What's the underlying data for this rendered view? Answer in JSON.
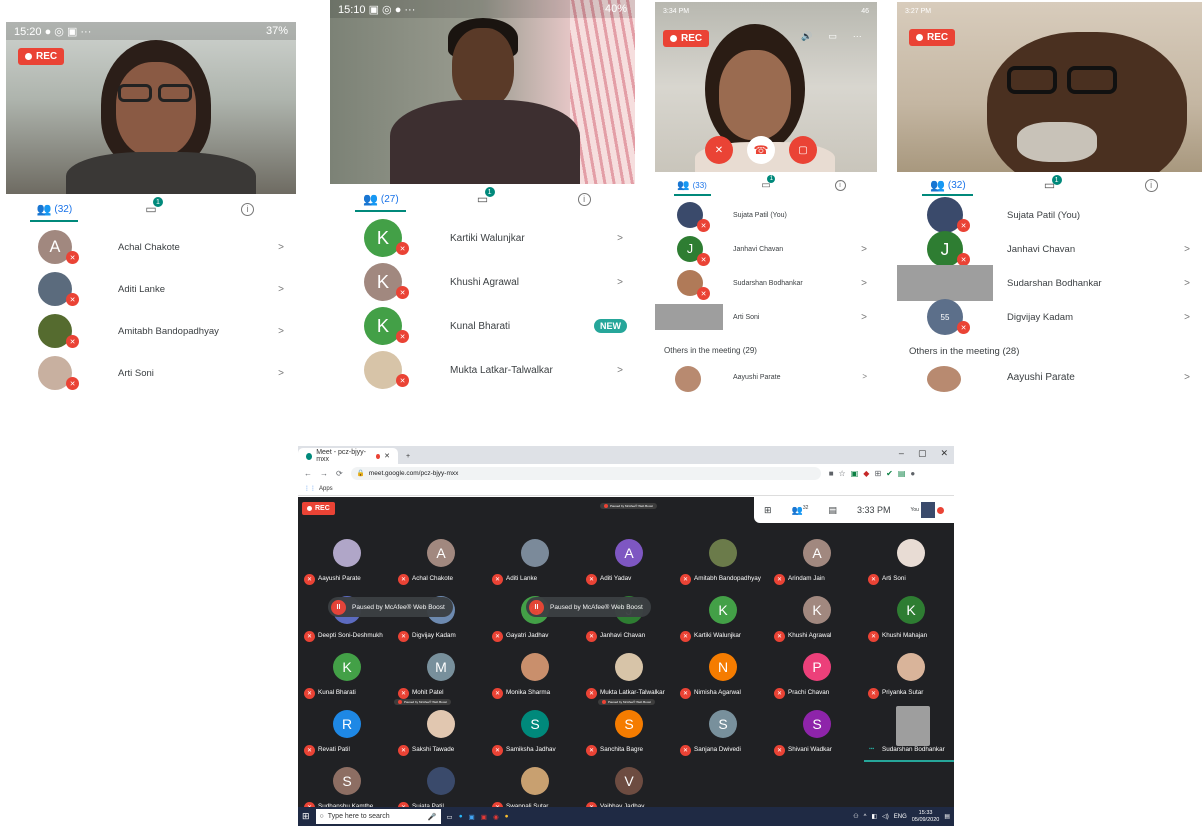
{
  "phone1": {
    "status_time": "15:20",
    "status_icons": "● ◎ ▣ ···",
    "battery": "37%",
    "rec": "REC",
    "participants_count": "(32)",
    "chat_badge": "1",
    "participants": [
      {
        "name": "Achal Chakote",
        "initial": "A",
        "color": "#a1887f"
      },
      {
        "name": "Aditi Lanke",
        "initial": "",
        "color": "#5b6b7d"
      },
      {
        "name": "Amitabh Bandopadhyay",
        "initial": "",
        "color": "#556b2f"
      },
      {
        "name": "Arti Soni",
        "initial": "",
        "color": "#c8b0a0"
      }
    ]
  },
  "phone2": {
    "status_time": "15:10",
    "status_icons": "▣ ◎ ● ···",
    "battery": "40%",
    "participants_count": "(27)",
    "chat_badge": "1",
    "participants": [
      {
        "name": "Kartiki Walunjkar",
        "initial": "K",
        "color": "#43a047",
        "new": ""
      },
      {
        "name": "Khushi Agrawal",
        "initial": "K",
        "color": "#a1887f",
        "new": ""
      },
      {
        "name": "Kunal Bharati",
        "initial": "K",
        "color": "#43a047",
        "new": "NEW"
      },
      {
        "name": "Mukta Latkar-Talwalkar",
        "initial": "",
        "color": "#d7c4a8",
        "new": ""
      }
    ]
  },
  "phone3": {
    "status_time": "3:34 PM",
    "signal": "46",
    "rec": "REC",
    "participants_count": "(33)",
    "chat_badge": "1",
    "participants": [
      {
        "name": "Sujata Patil (You)",
        "initial": "",
        "color": "#3a4a6b"
      },
      {
        "name": "Janhavi Chavan",
        "initial": "J",
        "color": "#2e7d32"
      },
      {
        "name": "Sudarshan Bodhankar",
        "initial": "",
        "color": "#b07a58"
      },
      {
        "name": "Arti Soni",
        "initial": "",
        "color": "#9e9e9e"
      }
    ],
    "others": "Others in the meeting (29)",
    "others_first": "Aayushi Parate"
  },
  "phone4": {
    "status_time": "3:27 PM",
    "rec": "REC",
    "participants_count": "(32)",
    "chat_badge": "1",
    "participants": [
      {
        "name": "Sujata Patil (You)",
        "initial": "",
        "color": "#3a4a6b"
      },
      {
        "name": "Janhavi Chavan",
        "initial": "J",
        "color": "#2e7d32"
      },
      {
        "name": "Sudarshan Bodhankar",
        "initial": "",
        "color": "#9e9e9e"
      },
      {
        "name": "Digvijay Kadam",
        "initial": "",
        "color": "#5c6f8a"
      }
    ],
    "digvijay_label": "55",
    "others": "Others in the meeting (28)",
    "others_first": "Aayushi Parate"
  },
  "desktop": {
    "tab_title": "Meet - pcz-bjyy-mxx",
    "new_tab": "+",
    "url": "meet.google.com/pcz-bjyy-mxx",
    "bookmarks_label": "Apps",
    "rec": "REC",
    "time": "3:33 PM",
    "participants_badge": "32",
    "you_label": "You",
    "paused_text": "Paused by McAfee® Web Boost",
    "tiny_paused_text": "Paused by McAfee® Web Boost",
    "pause_glyph": "II",
    "tiles": [
      {
        "name": "Aayushi Parate",
        "initial": "",
        "color": "#b0a6c8"
      },
      {
        "name": "Achal Chakote",
        "initial": "A",
        "color": "#a1887f"
      },
      {
        "name": "Aditi Lanke",
        "initial": "",
        "color": "#7b8a9a"
      },
      {
        "name": "Aditi Yadav",
        "initial": "A",
        "color": "#7e57c2"
      },
      {
        "name": "Amitabh Bandopadhyay",
        "initial": "",
        "color": "#6b7b4a"
      },
      {
        "name": "Arindam Jain",
        "initial": "A",
        "color": "#a1887f"
      },
      {
        "name": "Arti Soni",
        "initial": "",
        "color": "#e8dcd4"
      },
      {
        "name": "Deepti Soni-Deshmukh",
        "initial": "",
        "color": "#5c6bc0"
      },
      {
        "name": "Digvijay Kadam",
        "initial": "",
        "color": "#6d8ab0"
      },
      {
        "name": "Gayatri Jadhav",
        "initial": "G",
        "color": "#43a047"
      },
      {
        "name": "Janhavi Chavan",
        "initial": "J",
        "color": "#2e7d32"
      },
      {
        "name": "Kartiki Walunjkar",
        "initial": "K",
        "color": "#43a047"
      },
      {
        "name": "Khushi Agrawal",
        "initial": "K",
        "color": "#a1887f"
      },
      {
        "name": "Khushi Mahajan",
        "initial": "K",
        "color": "#2e7d32"
      },
      {
        "name": "Kunal Bharati",
        "initial": "K",
        "color": "#43a047"
      },
      {
        "name": "Mohit Patel",
        "initial": "M",
        "color": "#78909c"
      },
      {
        "name": "Monika Sharma",
        "initial": "",
        "color": "#c98f6c"
      },
      {
        "name": "Mukta Latkar-Talwalkar",
        "initial": "",
        "color": "#d7c4a8"
      },
      {
        "name": "Nimisha Agarwal",
        "initial": "N",
        "color": "#f57c00"
      },
      {
        "name": "Prachi Chavan",
        "initial": "P",
        "color": "#ec407a"
      },
      {
        "name": "Priyanka Sutar",
        "initial": "",
        "color": "#d9b49a"
      },
      {
        "name": "Revati Patil",
        "initial": "R",
        "color": "#1e88e5"
      },
      {
        "name": "Sakshi Tawade",
        "initial": "",
        "color": "#e1c7b0"
      },
      {
        "name": "Samiksha Jadhav",
        "initial": "S",
        "color": "#00897b"
      },
      {
        "name": "Sanchita Bagre",
        "initial": "S",
        "color": "#f57c00"
      },
      {
        "name": "Sanjana Dwivedi",
        "initial": "S",
        "color": "#78909c"
      },
      {
        "name": "Shivani Wadkar",
        "initial": "S",
        "color": "#8e24aa"
      },
      {
        "name": "Sudarshan Bodhankar",
        "initial": "",
        "color": "#9e9e9e"
      },
      {
        "name": "Sudhanshu Kamthe",
        "initial": "S",
        "color": "#8d6e63"
      },
      {
        "name": "Sujata Patil",
        "initial": "",
        "color": "#3a4a6b"
      },
      {
        "name": "Swapnali Sutar",
        "initial": "",
        "color": "#c8a070"
      },
      {
        "name": "Vaibhav Jadhav",
        "initial": "V",
        "color": "#6d4c41"
      }
    ],
    "taskbar_search": "Type here to search",
    "tray_lang": "ENG",
    "tray_time": "15:33",
    "tray_date": "05/09/2020"
  }
}
